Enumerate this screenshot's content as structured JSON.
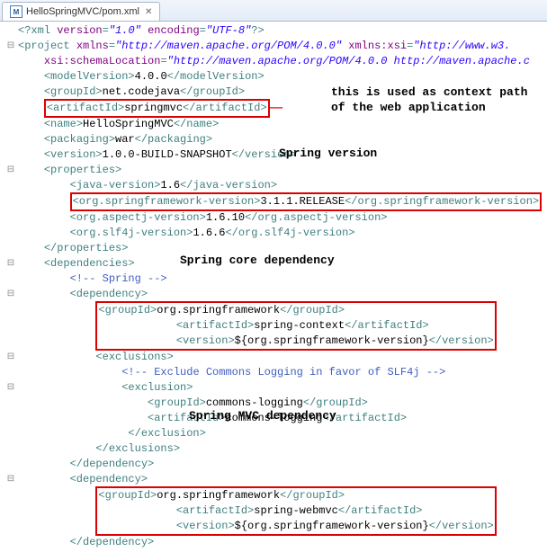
{
  "tab": {
    "title": "HelloSpringMVC/pom.xml"
  },
  "annotations": {
    "context_path_1": "this is used as context path",
    "context_path_2": "of the web application",
    "spring_version": "Spring version",
    "core_dep": "Spring core dependency",
    "mvc_dep": "Spring MVC dependency"
  },
  "xml": {
    "decl_version": "\"1.0\"",
    "decl_enc": "\"UTF-8\"",
    "proj_xmlns": "\"http://maven.apache.org/POM/4.0.0\"",
    "proj_xsi": "\"http://www.w3.",
    "schemaloc": "\"http://maven.apache.org/POM/4.0.0 http://maven.apache.c",
    "modelVersion": "4.0.0",
    "groupId": "net.codejava",
    "artifactId": "springmvc",
    "name": "HelloSpringMVC",
    "packaging": "war",
    "version": "1.0.0-BUILD-SNAPSHOT",
    "javaVersion": "1.6",
    "springVersion": "3.1.1.RELEASE",
    "aspectjVersion": "1.6.10",
    "slf4jVersion": "1.6.6",
    "springComment": " Spring ",
    "coreGroup": "org.springframework",
    "coreArtifact": "spring-context",
    "coreVersion": "${org.springframework-version}",
    "exclComment": " Exclude Commons Logging in favor of SLF4j ",
    "exclGroup": "commons-logging",
    "exclArtifact": "commons-logging",
    "mvcGroup": "org.springframework",
    "mvcArtifact": "spring-webmvc",
    "mvcVersion": "${org.springframework-version}"
  }
}
